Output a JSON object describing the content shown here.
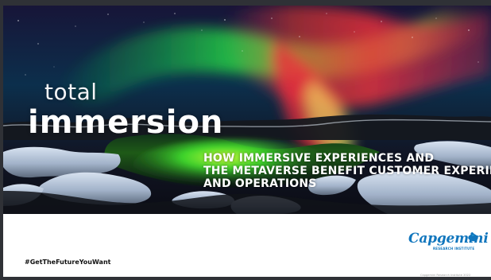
{
  "cover": {
    "title_small": "total",
    "title_large": "immersion",
    "subtitle_lines": [
      "HOW IMMERSIVE EXPERIENCES AND",
      "THE METAVERSE BENEFIT CUSTOMER EXPERIENCE",
      "AND OPERATIONS"
    ]
  },
  "footer": {
    "hashtag": "#GetTheFutureYouWant",
    "brand_name": "Capgemini",
    "brand_sub": "RESEARCH INSTITUTE",
    "copyright": "Capgemini Research Institute 2022"
  },
  "icons": {
    "logo": "spade-icon"
  },
  "colors": {
    "frame": "#2f3136",
    "brand": "#1176bd",
    "aurora_green": "#1dff4f",
    "aurora_red": "#ff3d2f",
    "text_light": "#ffffff"
  }
}
